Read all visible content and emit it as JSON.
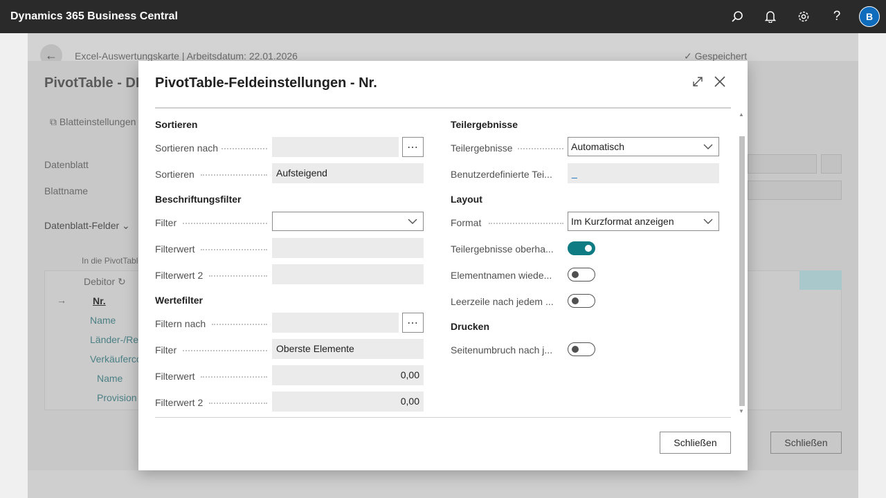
{
  "topbar": {
    "app_title": "Dynamics 365 Business Central",
    "avatar_letter": "B",
    "icons": [
      "search-icon",
      "bell-icon",
      "gear-icon",
      "help-icon"
    ]
  },
  "background_page": {
    "breadcrumb": "Excel-Auswertungskarte | Arbeitsdatum: 22.01.2026",
    "saved_label": "Gespeichert",
    "dialog_title": "PivotTable - DE",
    "action_blatteinstellungen": "Blatteinstellungen",
    "field_datenblatt": "Datenblatt",
    "field_blattname": "Blattname",
    "group_datenblatt_felder": "Datenblatt-Felder",
    "table_caption": "In die PivotTable",
    "table_column": "Debitor",
    "rows": [
      "Nr.",
      "Name",
      "Länder-/Re",
      "Verkäuferco",
      "Name",
      "Provision"
    ],
    "close_label": "Schließen"
  },
  "modal": {
    "title": "PivotTable-Feldeinstellungen - Nr.",
    "left": {
      "sortieren_section": "Sortieren",
      "sortieren_nach_label": "Sortieren nach",
      "sortieren_nach_value": "",
      "sortieren_label": "Sortieren",
      "sortieren_value": "Aufsteigend",
      "beschriftungsfilter_section": "Beschriftungsfilter",
      "filter_label": "Filter",
      "filter_value": "",
      "filterwert_label": "Filterwert",
      "filterwert_value": "",
      "filterwert2_label": "Filterwert 2",
      "filterwert2_value": "",
      "wertefilter_section": "Wertefilter",
      "filtern_nach_label": "Filtern nach",
      "filtern_nach_value": "",
      "wf_filter_label": "Filter",
      "wf_filter_value": "Oberste Elemente",
      "wf_filterwert_label": "Filterwert",
      "wf_filterwert_value": "0,00",
      "wf_filterwert2_label": "Filterwert 2",
      "wf_filterwert2_value": "0,00"
    },
    "right": {
      "teilergebnisse_section": "Teilergebnisse",
      "teilergebnisse_label": "Teilergebnisse",
      "teilergebnisse_value": "Automatisch",
      "benutzerdef_label": "Benutzerdefinierte Tei...",
      "benutzerdef_value": "_",
      "layout_section": "Layout",
      "format_label": "Format",
      "format_value": "Im Kurzformat anzeigen",
      "teilergebnisse_oben_label": "Teilergebnisse oberha...",
      "teilergebnisse_oben_on": true,
      "elementnamen_label": "Elementnamen wiede...",
      "elementnamen_on": false,
      "leerzeile_label": "Leerzeile nach jedem ...",
      "leerzeile_on": false,
      "drucken_section": "Drucken",
      "seitenumbruch_label": "Seitenumbruch nach j...",
      "seitenumbruch_on": false
    },
    "close_label": "Schließen"
  },
  "colors": {
    "accent": "#0f7b83",
    "topbar": "#2a2a2a",
    "avatar": "#0f6cbd"
  }
}
